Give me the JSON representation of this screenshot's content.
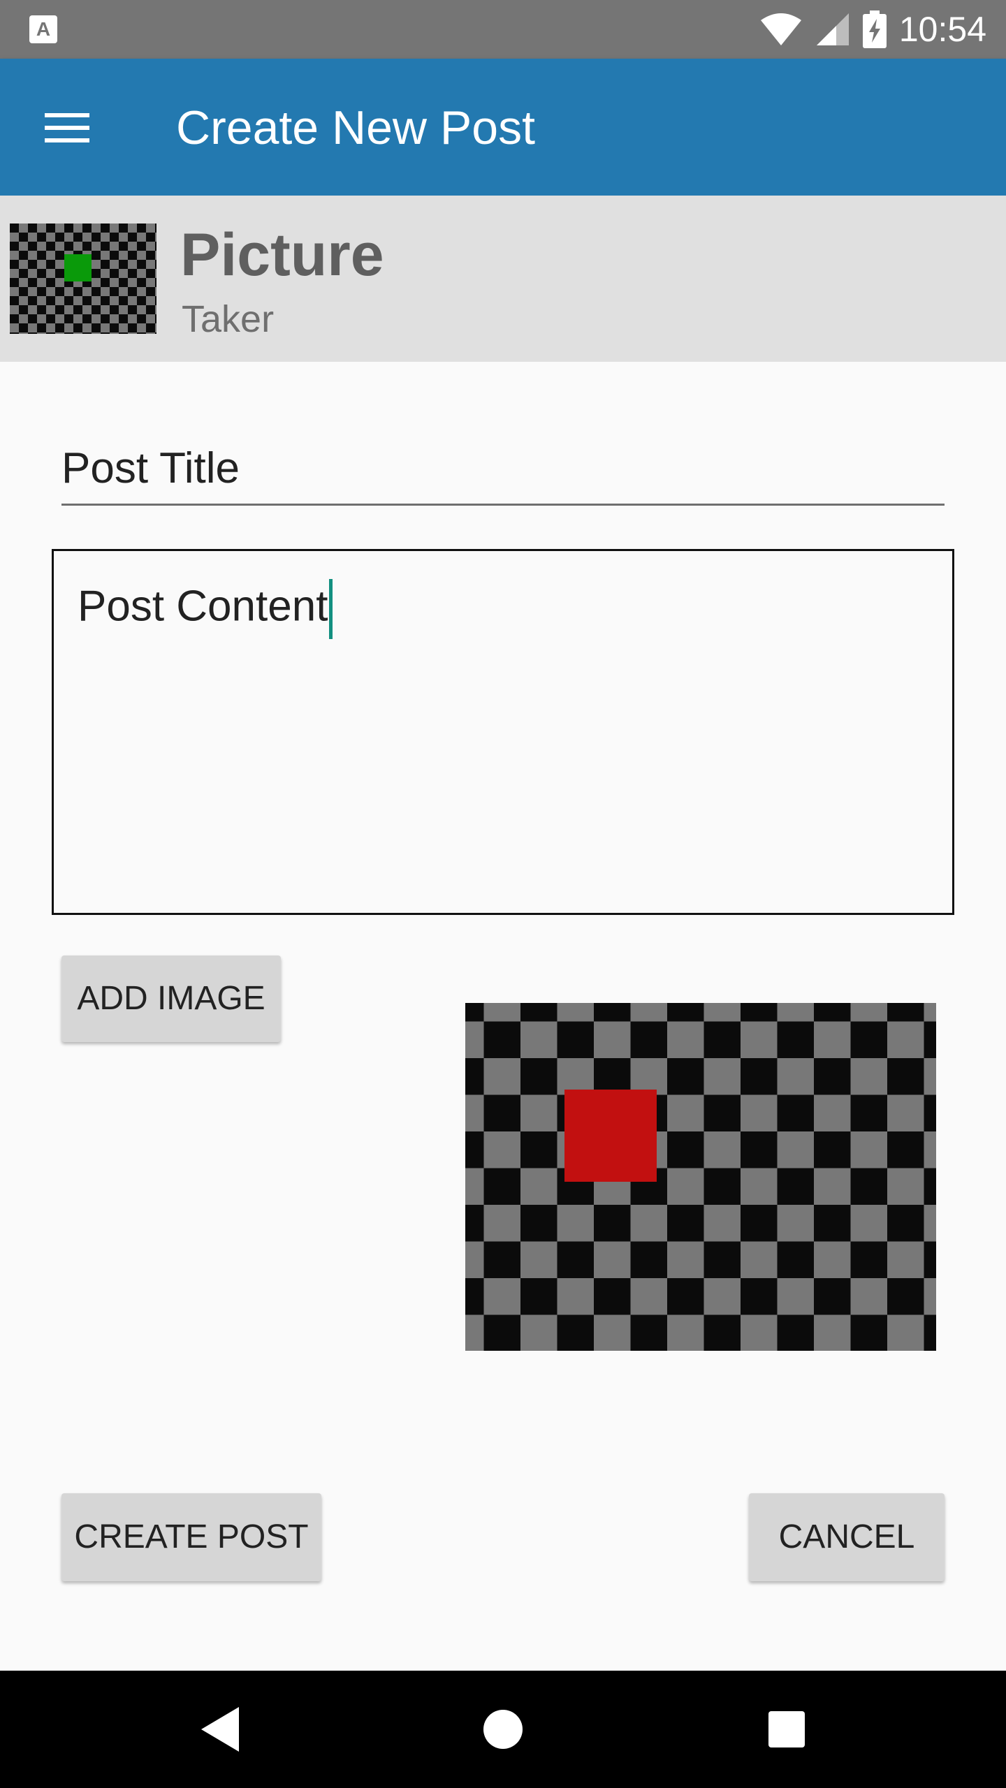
{
  "status_bar": {
    "time": "10:54",
    "left_icon": "A",
    "icons": [
      "wifi-icon",
      "cell-signal-icon",
      "battery-charging-icon"
    ]
  },
  "app_bar": {
    "title": "Create New Post",
    "menu_icon": "menu-icon",
    "color": "#2379b0"
  },
  "brand": {
    "title": "Picture",
    "subtitle": "Taker"
  },
  "form": {
    "title_placeholder": "Post Title",
    "content_value": "Post Content",
    "add_image_label": "ADD IMAGE",
    "create_post_label": "CREATE POST",
    "cancel_label": "CANCEL"
  },
  "nav_bar": {
    "icons": [
      "back-icon",
      "home-icon",
      "recents-icon"
    ]
  },
  "colors": {
    "accent": "#138f80",
    "checker_dark": "#0b0b0b",
    "checker_light": "#787878",
    "preview_square": "#c21010",
    "logo_square": "#0a9a0a"
  }
}
